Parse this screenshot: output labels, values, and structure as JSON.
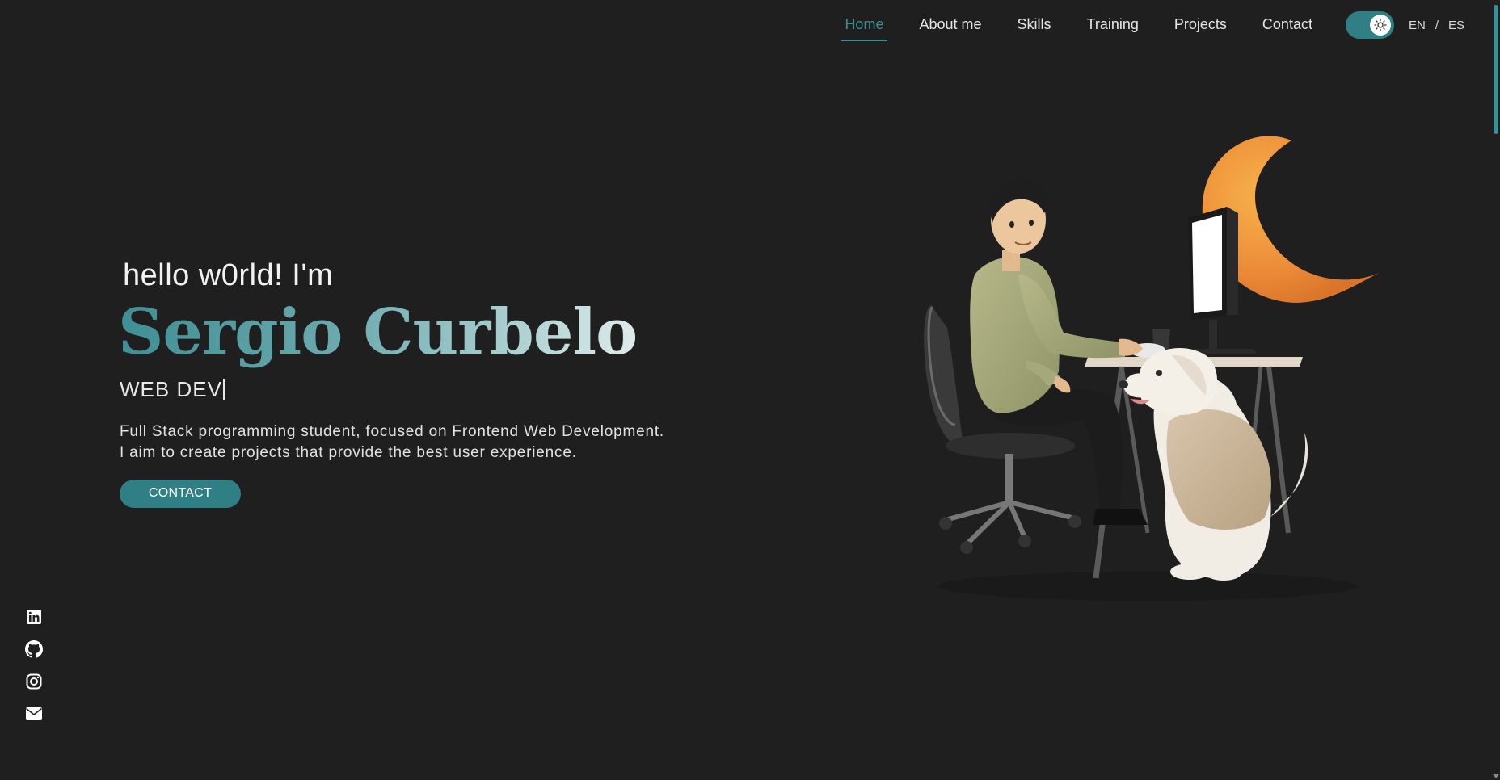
{
  "nav": {
    "items": [
      {
        "label": "Home",
        "active": true
      },
      {
        "label": "About me",
        "active": false
      },
      {
        "label": "Skills",
        "active": false
      },
      {
        "label": "Training",
        "active": false
      },
      {
        "label": "Projects",
        "active": false
      },
      {
        "label": "Contact",
        "active": false
      }
    ],
    "theme_toggle_icon": "sun-icon",
    "lang": {
      "en": "EN",
      "separator": "/",
      "es": "ES"
    }
  },
  "hero": {
    "greeting": "hello w0rld! I'm",
    "name": "Sergio Curbelo",
    "role": "WEB DEV",
    "description_line1": "Full Stack programming student, focused on Frontend Web Development.",
    "description_line2": "I aim to create projects that provide the best user experience.",
    "contact_label": "CONTACT"
  },
  "social": [
    "linkedin-icon",
    "github-icon",
    "instagram-icon",
    "mail-icon"
  ],
  "colors": {
    "background": "#1f1f1f",
    "accent": "#3d8f94",
    "text": "#e8e8e8"
  }
}
